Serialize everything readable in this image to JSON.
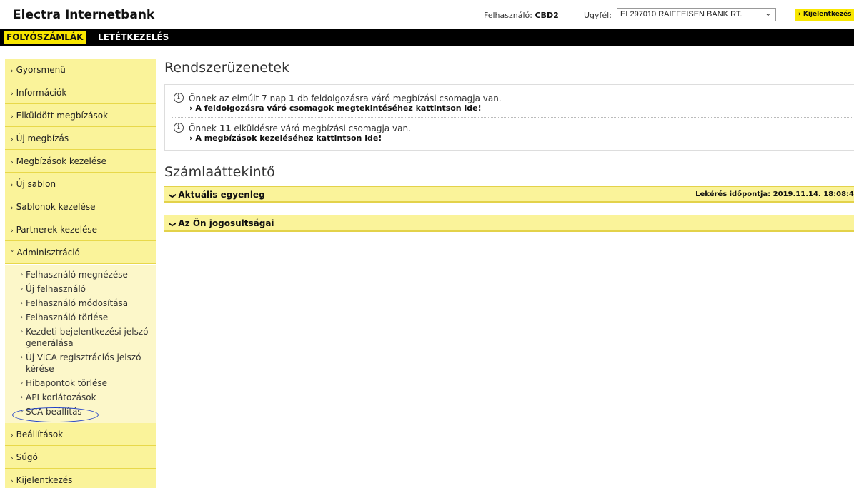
{
  "header": {
    "app_title": "Electra Internetbank",
    "user_label": "Felhasználó:",
    "user_value": "CBD2",
    "client_label": "Ügyfél:",
    "client_value": "EL297010 RAIFFEISEN BANK RT.",
    "logout_label": "› Kijelentkezés"
  },
  "nav": {
    "tabs": [
      {
        "label": "FOLYÓSZÁMLÁK",
        "active": true
      },
      {
        "label": "LETÉTKEZELÉS",
        "active": false
      }
    ]
  },
  "sidebar": {
    "items": [
      {
        "label": "Gyorsmenü"
      },
      {
        "label": "Információk"
      },
      {
        "label": "Elküldött megbízások"
      },
      {
        "label": "Új megbízás"
      },
      {
        "label": "Megbízások kezelése"
      },
      {
        "label": "Új sablon"
      },
      {
        "label": "Sablonok kezelése"
      },
      {
        "label": "Partnerek kezelése"
      },
      {
        "label": "Adminisztráció"
      },
      {
        "label": "Beállítások"
      },
      {
        "label": "Súgó"
      },
      {
        "label": "Kijelentkezés"
      }
    ],
    "admin_sub": [
      {
        "label": "Felhasználó megnézése"
      },
      {
        "label": "Új felhasználó"
      },
      {
        "label": "Felhasználó módosítása"
      },
      {
        "label": "Felhasználó törlése"
      },
      {
        "label": "Kezdeti bejelentkezési jelszó generálása"
      },
      {
        "label": "Új ViCA regisztrációs jelszó kérése"
      },
      {
        "label": "Hibapontok törlése"
      },
      {
        "label": "API korlátozások"
      },
      {
        "label": "SCA beállítás"
      }
    ]
  },
  "main": {
    "system_messages_title": "Rendszerüzenetek",
    "messages": [
      {
        "pre": "Önnek az elmúlt 7 nap ",
        "bold": "1",
        "post": " db feldolgozásra váró megbízási csomagja van.",
        "link": "A feldolgozásra váró csomagok megtekintéséhez kattintson ide!"
      },
      {
        "pre": "Önnek ",
        "bold": "11",
        "post": " elküldésre váró megbízási csomagja van.",
        "link": "A megbízások kezeléséhez kattintson ide!"
      }
    ],
    "overview_title": "Számlaáttekintő",
    "balance_label": "Aktuális egyenleg",
    "query_time": "Lekérés időpontja: 2019.11.14. 18:08:4",
    "rights_label": "Az Ön jogosultságai"
  },
  "icons": {
    "chevron_right": "›",
    "chevron_down": "⌄",
    "info": "i"
  },
  "colors": {
    "accent_yellow": "#f8e600",
    "menu_yellow": "#faf39a",
    "nav_black": "#000000",
    "annotation_blue": "#1e3fc8"
  }
}
